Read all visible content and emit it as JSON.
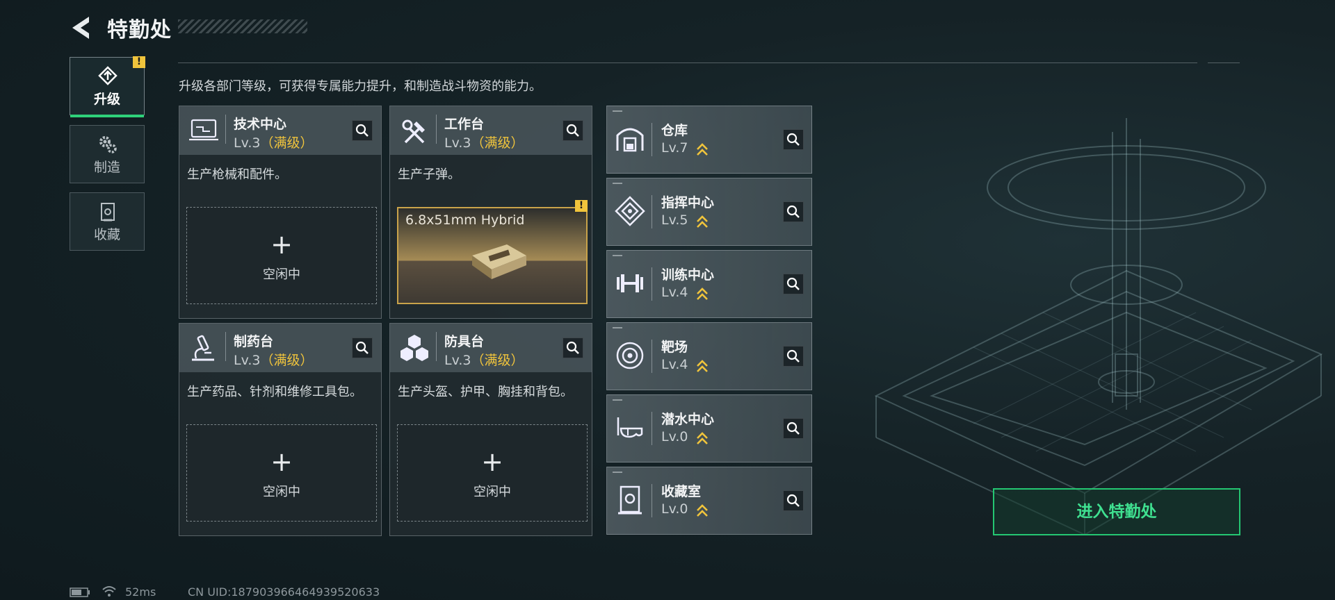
{
  "header": {
    "title": "特勤处"
  },
  "subtitle": "升级各部门等级，可获得专属能力提升，和制造战斗物资的能力。",
  "tabs": [
    {
      "label": "升级",
      "active": true,
      "alert": "!"
    },
    {
      "label": "制造"
    },
    {
      "label": "收藏"
    }
  ],
  "cards": [
    {
      "name": "技术中心",
      "level": "Lv.3",
      "max": "（满级）",
      "desc": "生产枪械和配件。",
      "slot": {
        "plus": "+",
        "state": "空闲中"
      }
    },
    {
      "name": "工作台",
      "level": "Lv.3",
      "max": "（满级）",
      "desc": "生产子弹。",
      "product": {
        "name": "6.8x51mm Hybrid",
        "alert": "!"
      }
    },
    {
      "name": "制药台",
      "level": "Lv.3",
      "max": "（满级）",
      "desc": "生产药品、针剂和维修工具包。",
      "slot": {
        "plus": "+",
        "state": "空闲中"
      }
    },
    {
      "name": "防具台",
      "level": "Lv.3",
      "max": "（满级）",
      "desc": "生产头盔、护甲、胸挂和背包。",
      "slot": {
        "plus": "+",
        "state": "空闲中"
      }
    }
  ],
  "facilities": [
    {
      "name": "仓库",
      "level": "Lv.7"
    },
    {
      "name": "指挥中心",
      "level": "Lv.5"
    },
    {
      "name": "训练中心",
      "level": "Lv.4"
    },
    {
      "name": "靶场",
      "level": "Lv.4"
    },
    {
      "name": "潜水中心",
      "level": "Lv.0"
    },
    {
      "name": "收藏室",
      "level": "Lv.0"
    }
  ],
  "enter_button": "进入特勤处",
  "footer": {
    "ping": "52ms",
    "uid": "CN UID:187903966464939520633"
  },
  "colors": {
    "accent_green": "#24c772",
    "max_gold": "#f0c43c"
  }
}
